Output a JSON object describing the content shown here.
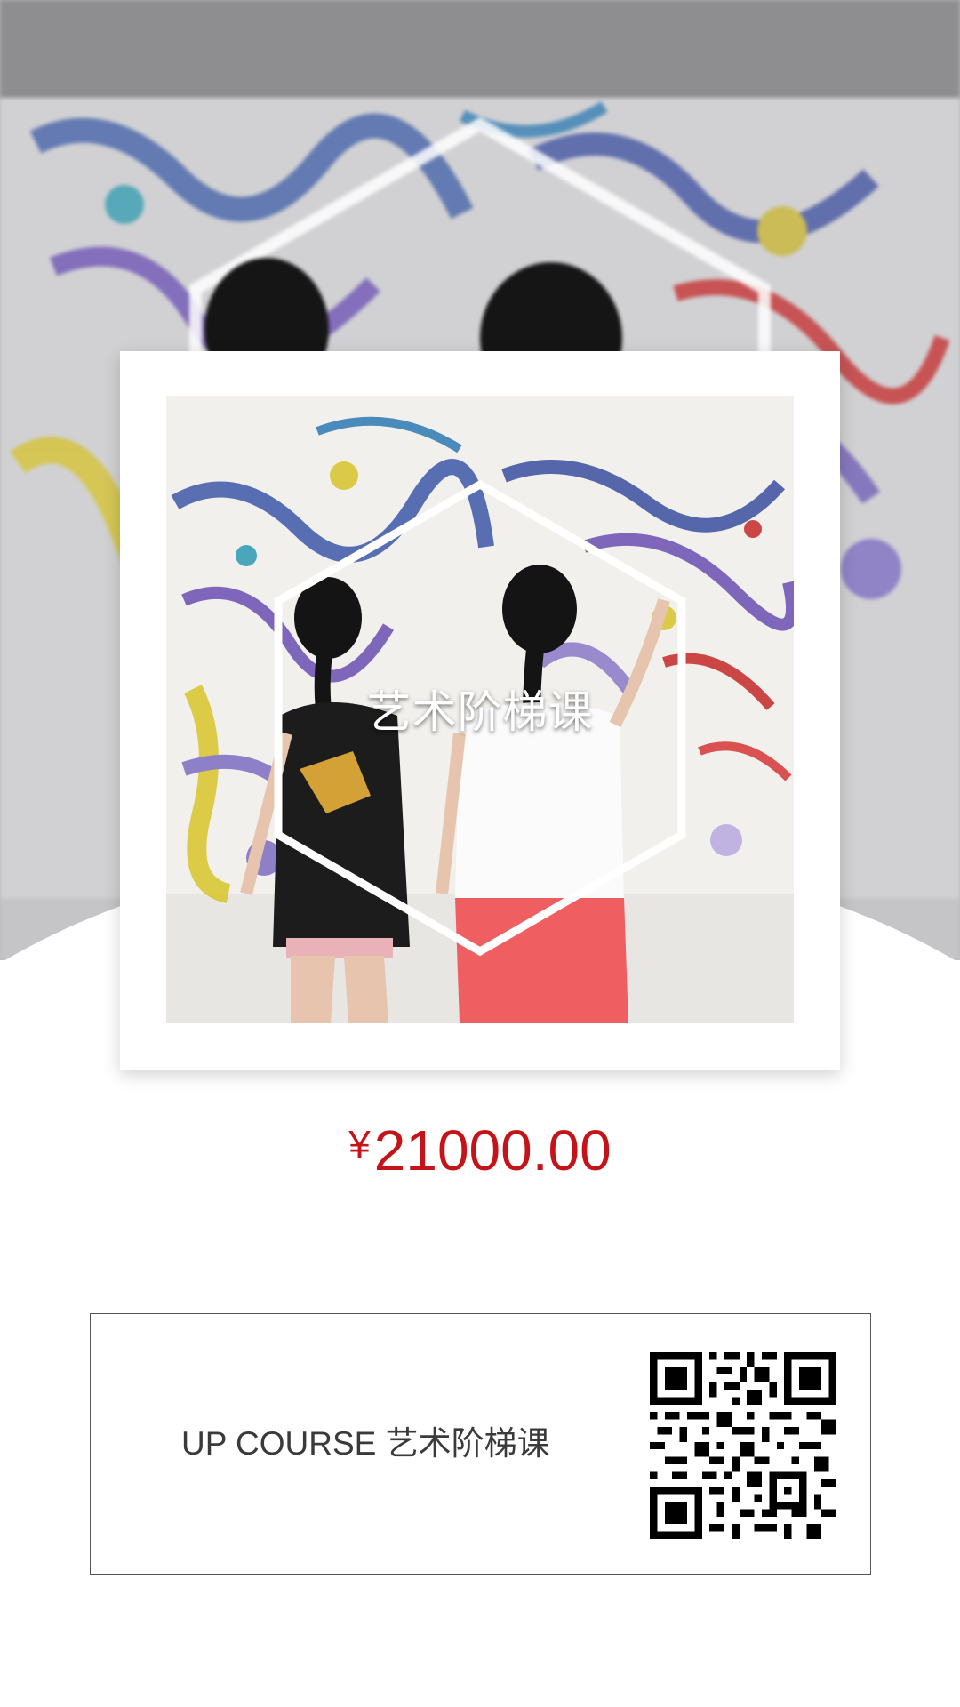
{
  "poster": {
    "image_title": "艺术阶梯课",
    "price_symbol": "¥",
    "price_value": "21000.00",
    "price_color": "#c41419"
  },
  "qr_panel": {
    "label": "UP COURSE 艺术阶梯课",
    "qr_icon": "qr-code-icon"
  }
}
